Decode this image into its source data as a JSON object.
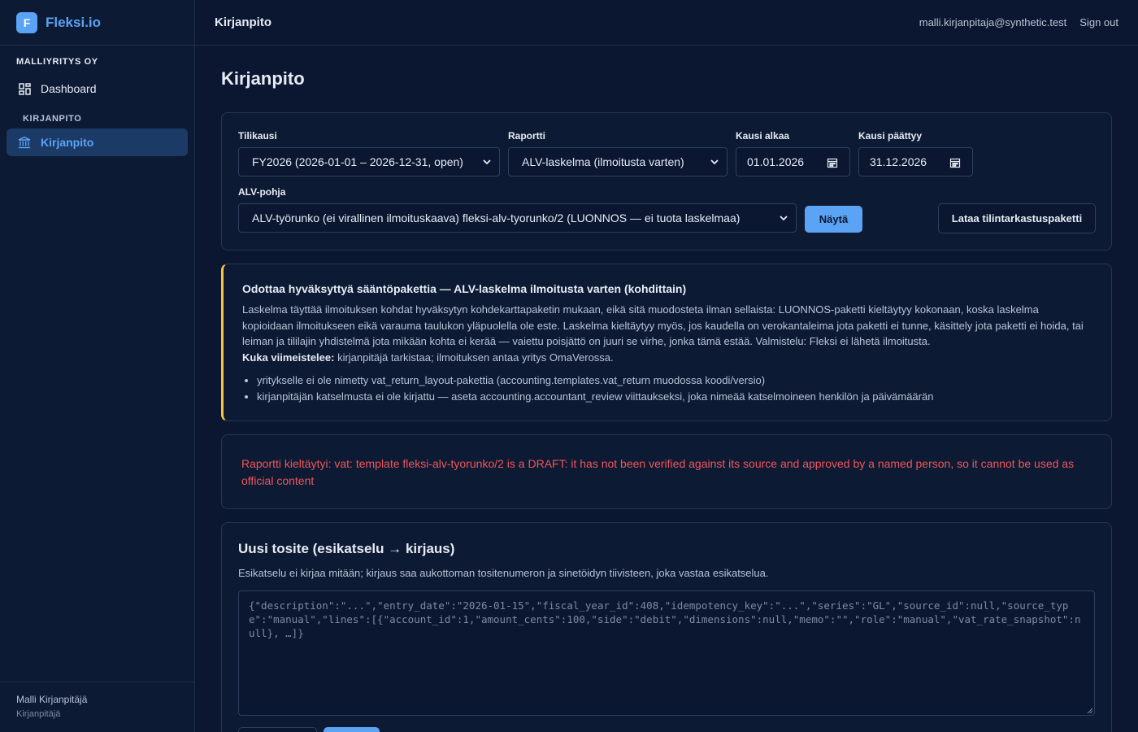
{
  "brand": {
    "logo_letter": "F",
    "name": "Fleksi.io"
  },
  "sidebar": {
    "company": "MALLIYRITYS OY",
    "items": [
      {
        "label": "Dashboard",
        "icon": "dashboard-icon"
      },
      {
        "label": "Kirjanpito",
        "icon": "bank-icon",
        "active": true
      }
    ],
    "section": "KIRJANPITO",
    "user": {
      "name": "Malli Kirjanpitäjä",
      "role": "Kirjanpitäjä"
    }
  },
  "header": {
    "title": "Kirjanpito",
    "email": "malli.kirjanpitaja@synthetic.test",
    "signout": "Sign out"
  },
  "page": {
    "title": "Kirjanpito"
  },
  "filters": {
    "tilikausi_label": "Tilikausi",
    "tilikausi_value": "FY2026 (2026-01-01 – 2026-12-31, open)",
    "raportti_label": "Raportti",
    "raportti_value": "ALV-laskelma (ilmoitusta varten)",
    "kausi_alkaa_label": "Kausi alkaa",
    "kausi_alkaa_value": "01.01.2026",
    "kausi_paattyy_label": "Kausi päättyy",
    "kausi_paattyy_value": "31.12.2026",
    "alv_pohja_label": "ALV-pohja",
    "alv_pohja_value": "ALV-työrunko (ei virallinen ilmoituskaava) fleksi-alv-tyorunko/2 (LUONNOS — ei tuota laskelmaa)",
    "show_button": "Näytä",
    "download_button": "Lataa tilintarkastuspaketti"
  },
  "warning": {
    "title": "Odottaa hyväksyttyä sääntöpakettia — ALV-laskelma ilmoitusta varten (kohdittain)",
    "body": "Laskelma täyttää ilmoituksen kohdat hyväksytyn kohdekarttapaketin mukaan, eikä sitä muodosteta ilman sellaista: LUONNOS-paketti kieltäytyy kokonaan, koska laskelma kopioidaan ilmoitukseen eikä varauma taulukon yläpuolella ole este. Laskelma kieltäytyy myös, jos kaudella on verokantaleima jota paketti ei tunne, käsittely jota paketti ei hoida, tai leiman ja tililajin yhdistelmä jota mikään kohta ei kerää — vaiettu poisjättö on juuri se virhe, jonka tämä estää. Valmistelu: Fleksi ei lähetä ilmoitusta.",
    "finisher_label": "Kuka viimeistelee:",
    "finisher_text": " kirjanpitäjä tarkistaa; ilmoituksen antaa yritys OmaVerossa.",
    "items": [
      "yritykselle ei ole nimetty vat_return_layout-pakettia (accounting.templates.vat_return muodossa koodi/versio)",
      "kirjanpitäjän katselmusta ei ole kirjattu — aseta accounting.accountant_review viittaukseksi, joka nimeää katselmoineen henkilön ja päivämäärän"
    ]
  },
  "error": {
    "text": "Raportti kieltäytyi: vat: template fleksi-alv-tyorunko/2 is a DRAFT: it has not been verified against its source and approved by a named person, so it cannot be used as official content"
  },
  "entry": {
    "title": "Uusi tosite (esikatselu → kirjaus)",
    "subtitle": "Esikatselu ei kirjaa mitään; kirjaus saa aukottoman tositenumeron ja sinetöidyn tiivisteen, joka vastaa esikatselua.",
    "placeholder": "{\"description\":\"...\",\"entry_date\":\"2026-01-15\",\"fiscal_year_id\":408,\"idempotency_key\":\"...\",\"series\":\"GL\",\"source_id\":null,\"source_type\":\"manual\",\"lines\":[{\"account_id\":1,\"amount_cents\":100,\"side\":\"debit\",\"dimensions\":null,\"memo\":\"\",\"role\":\"manual\",\"vat_rate_snapshot\":null}, …]}"
  },
  "colors": {
    "accent": "#5aa3f5",
    "warning": "#f5c542",
    "error": "#f0555a",
    "background": "#0b1730"
  }
}
